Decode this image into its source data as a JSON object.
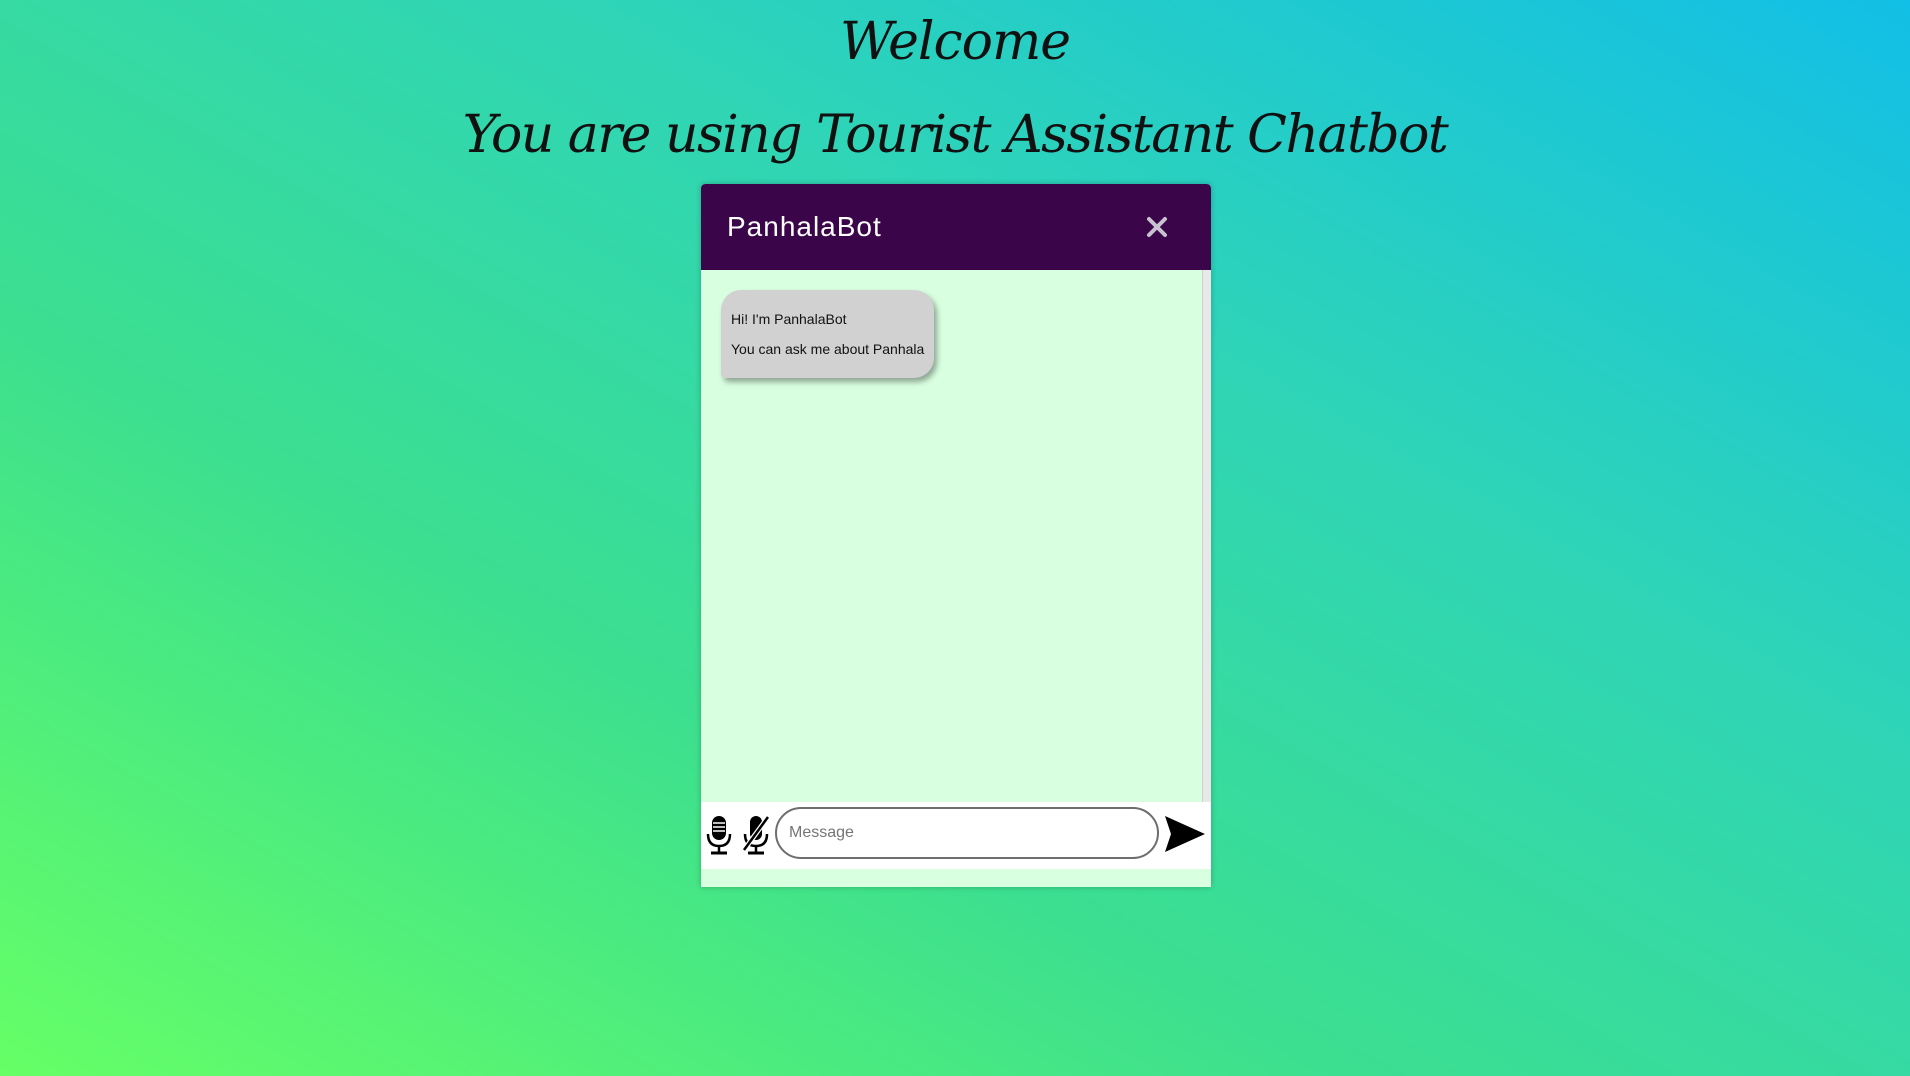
{
  "page": {
    "welcome": "Welcome",
    "subtitle": "You are using Tourist Assistant Chatbot"
  },
  "chat": {
    "bot_name": "PanhalaBot",
    "close_icon": "close-icon",
    "messages": [
      {
        "sender": "bot",
        "lines": [
          "Hi! I'm PanhalaBot",
          "You can ask me about Panhala"
        ]
      }
    ],
    "input": {
      "value": "",
      "placeholder": "Message"
    },
    "icons": {
      "mic": "mic-icon",
      "mic_off": "mic-off-icon",
      "send": "send-icon"
    }
  },
  "colors": {
    "header_bg": "#3b0649",
    "chat_bg": "#d9ffe1",
    "bubble_bg": "#d1d1d1"
  }
}
